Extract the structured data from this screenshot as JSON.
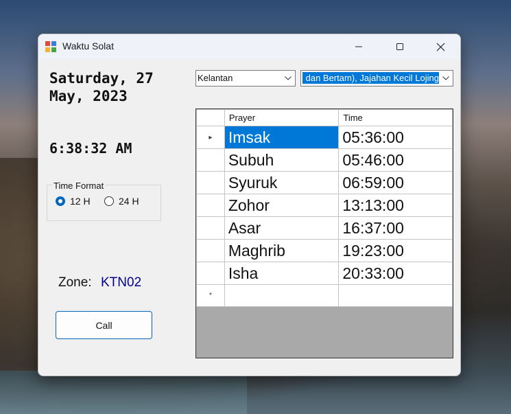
{
  "window": {
    "title": "Waktu Solat"
  },
  "left_panel": {
    "date": "Saturday, 27 May, 2023",
    "time": "6:38:32 AM",
    "time_format": {
      "title": "Time Format",
      "option_12": "12 H",
      "option_24": "24 H",
      "selected": "12 H"
    },
    "zone_label": "Zone:",
    "zone_value": "KTN02",
    "call_label": "Call"
  },
  "filters": {
    "state": "Kelantan",
    "zone": "dan Bertam), Jajahan Kecil Lojing"
  },
  "grid": {
    "columns": [
      "Prayer",
      "Time"
    ],
    "rows": [
      {
        "prayer": "Imsak",
        "time": "05:36:00"
      },
      {
        "prayer": "Subuh",
        "time": "05:46:00"
      },
      {
        "prayer": "Syuruk",
        "time": "06:59:00"
      },
      {
        "prayer": "Zohor",
        "time": "13:13:00"
      },
      {
        "prayer": "Asar",
        "time": "16:37:00"
      },
      {
        "prayer": "Maghrib",
        "time": "19:23:00"
      },
      {
        "prayer": "Isha",
        "time": "20:33:00"
      }
    ],
    "current_row_marker": "▸",
    "new_row_marker": "*"
  },
  "colors": {
    "accent": "#0078d7",
    "zone_text": "#00008b"
  },
  "icons": {
    "app": "app-icon",
    "minimize": "minimize-icon",
    "maximize": "maximize-icon",
    "close": "close-icon",
    "dropdown": "chevron-down-icon"
  }
}
